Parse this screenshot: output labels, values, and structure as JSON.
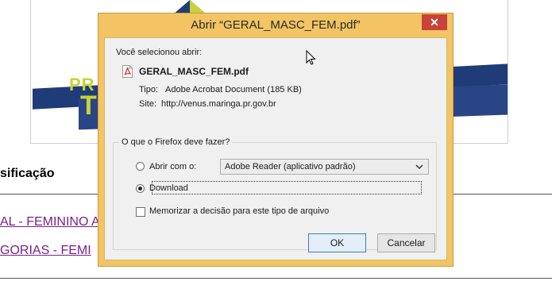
{
  "page": {
    "heading": "sificação",
    "links": [
      "AL - FEMININO A",
      "GORIAS - FEMI"
    ],
    "logo": {
      "line1": "PR",
      "line2": "T"
    }
  },
  "dialog": {
    "title": "Abrir “GERAL_MASC_FEM.pdf”",
    "close_label": "✕",
    "selected_label": "Você selecionou abrir:",
    "file_name": "GERAL_MASC_FEM.pdf",
    "type_label": "Tipo:",
    "type_value": "Adobe Acrobat Document (185 KB)",
    "site_label": "Site:",
    "site_value": "http://venus.maringa.pr.gov.br",
    "group_title": "O que o Firefox deve fazer?",
    "open_with_label": "Abrir com o:",
    "open_with_value": "Adobe Reader  (aplicativo padrão)",
    "download_label": "Download",
    "remember_label": "Memorizar a decisão para este tipo de arquivo",
    "ok_label": "OK",
    "cancel_label": "Cancelar",
    "selected_option": "download",
    "remember_checked": false
  },
  "colors": {
    "titlebar": "#f2c464",
    "close": "#c7433a",
    "link": "#7a1f8c",
    "logo_blue": "#1f3b78",
    "logo_yellow": "#c8d23a"
  },
  "icons": [
    "pdf-file-icon",
    "close-icon",
    "chevron-down-icon",
    "mouse-cursor-icon"
  ]
}
